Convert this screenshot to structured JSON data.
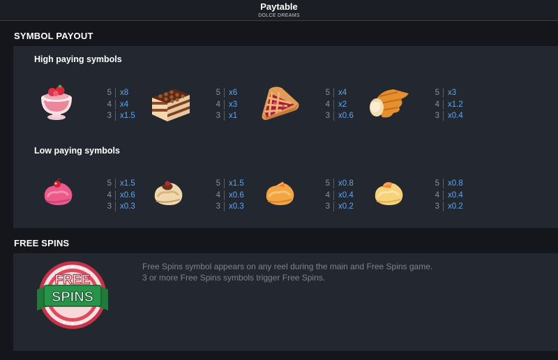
{
  "header": {
    "title": "Paytable",
    "subtitle": "DOLCE DREAMS"
  },
  "symbol_payout": {
    "title": "SYMBOL PAYOUT",
    "high": {
      "title": "High paying symbols",
      "symbols": [
        {
          "icon": "strawberry-cup-icon",
          "payouts": [
            {
              "count": "5",
              "mult": "x8"
            },
            {
              "count": "4",
              "mult": "x4"
            },
            {
              "count": "3",
              "mult": "x1.5"
            }
          ]
        },
        {
          "icon": "tiramisu-cake-icon",
          "payouts": [
            {
              "count": "5",
              "mult": "x6"
            },
            {
              "count": "4",
              "mult": "x3"
            },
            {
              "count": "3",
              "mult": "x1"
            }
          ]
        },
        {
          "icon": "cherry-pie-icon",
          "payouts": [
            {
              "count": "5",
              "mult": "x4"
            },
            {
              "count": "4",
              "mult": "x2"
            },
            {
              "count": "3",
              "mult": "x0.6"
            }
          ]
        },
        {
          "icon": "cream-horn-icon",
          "payouts": [
            {
              "count": "5",
              "mult": "x3"
            },
            {
              "count": "4",
              "mult": "x1.2"
            },
            {
              "count": "3",
              "mult": "x0.4"
            }
          ]
        }
      ]
    },
    "low": {
      "title": "Low paying symbols",
      "symbols": [
        {
          "icon": "strawberry-gelato-icon",
          "payouts": [
            {
              "count": "5",
              "mult": "x1.5"
            },
            {
              "count": "4",
              "mult": "x0.6"
            },
            {
              "count": "3",
              "mult": "x0.3"
            }
          ]
        },
        {
          "icon": "chocolate-gelato-icon",
          "payouts": [
            {
              "count": "5",
              "mult": "x1.5"
            },
            {
              "count": "4",
              "mult": "x0.6"
            },
            {
              "count": "3",
              "mult": "x0.3"
            }
          ]
        },
        {
          "icon": "orange-gelato-icon",
          "payouts": [
            {
              "count": "5",
              "mult": "x0.8"
            },
            {
              "count": "4",
              "mult": "x0.4"
            },
            {
              "count": "3",
              "mult": "x0.2"
            }
          ]
        },
        {
          "icon": "peach-gelato-icon",
          "payouts": [
            {
              "count": "5",
              "mult": "x0.8"
            },
            {
              "count": "4",
              "mult": "x0.4"
            },
            {
              "count": "3",
              "mult": "x0.2"
            }
          ]
        }
      ]
    }
  },
  "free_spins": {
    "title": "FREE SPINS",
    "badge_text": [
      "FREE",
      "SPINS"
    ],
    "description": [
      "Free Spins symbol appears on any reel during the main and Free Spins game.",
      "3 or more Free Spins symbols trigger Free Spins."
    ]
  },
  "colors": {
    "background": "#14161b",
    "panel": "#232830",
    "multiplier": "#5ea5f0",
    "count": "#8b9099",
    "description": "#7d838d"
  }
}
